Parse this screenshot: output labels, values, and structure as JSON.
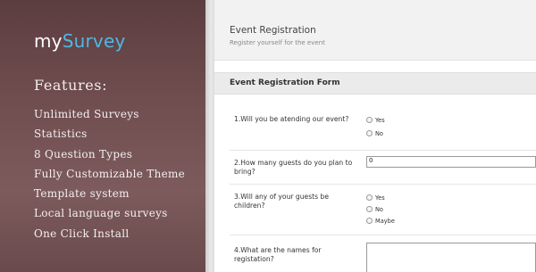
{
  "promo": {
    "logo_my": "my",
    "logo_survey": "Survey",
    "features_title": "Features:",
    "features": [
      "Unlimited Surveys",
      "Statistics",
      "8 Question Types",
      "Fully Customizable Theme",
      "Template system",
      "Local language surveys",
      "One Click Install"
    ]
  },
  "event": {
    "title": "Event Registration",
    "subtitle": "Register yourself for the event"
  },
  "form": {
    "title": "Event Registration Form",
    "questions": [
      {
        "label": "1.Will you be atending our event?",
        "options": [
          "Yes",
          "No"
        ]
      },
      {
        "label": "2.How many guests do you plan to bring?",
        "value": "0"
      },
      {
        "label": "3.Will any of your guests be children?",
        "options": [
          "Yes",
          "No",
          "Maybe"
        ]
      },
      {
        "label": "4.What are the names for registation?",
        "value": ""
      }
    ]
  },
  "colors": {
    "panel": "#6f4d4f",
    "logo_accent": "#4fb7e6"
  }
}
